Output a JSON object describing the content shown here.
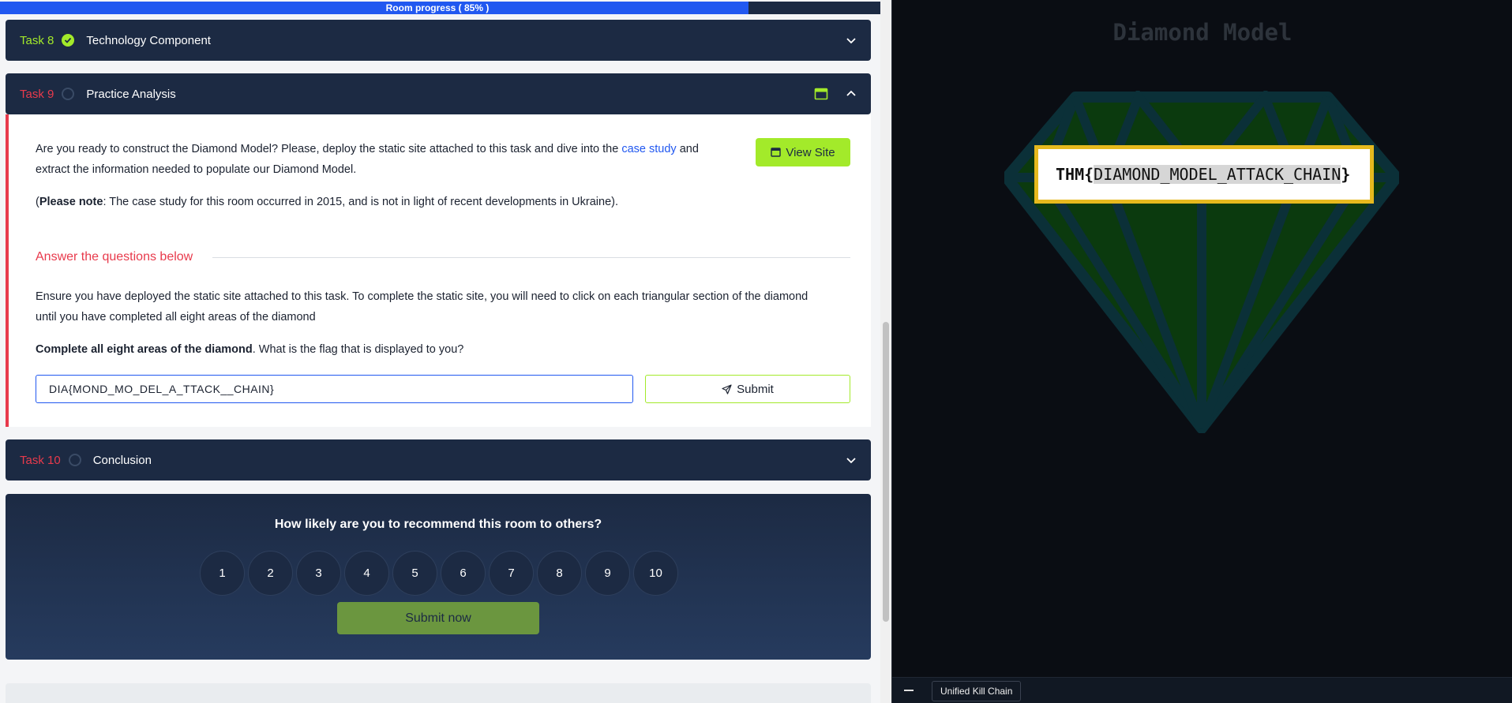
{
  "progress": {
    "label": "Room progress ( 85% )",
    "percent": 85
  },
  "tasks": [
    {
      "num": "Task 8",
      "title": "Technology Component",
      "status": "complete"
    },
    {
      "num": "Task 9",
      "title": "Practice Analysis",
      "status": "incomplete"
    },
    {
      "num": "Task 10",
      "title": "Conclusion",
      "status": "incomplete"
    }
  ],
  "task9": {
    "intro_part1": "Are you ready to construct the Diamond Model? Please, deploy the static site attached to this task and dive into the ",
    "intro_link": "case study",
    "intro_part2": " and",
    "intro_line2": "extract the information needed to populate our Diamond Model.",
    "note_open": "(",
    "note_bold": "Please note",
    "note_rest": ": The case study for this room occurred in 2015, and is not in light of recent developments in Ukraine).",
    "view_site_label": "View Site",
    "answer_heading": "Answer the questions below",
    "question_line1": "Ensure you have deployed the static site attached to this task. To complete the static site, you will need to click on each triangular section of the diamond",
    "question_line2": "until you have completed all eight areas of the diamond",
    "q_bold": "Complete all eight areas of the diamond",
    "q_rest": ". What is the flag that is displayed to you?",
    "answer_value": "DIA{MOND_MO_DEL_A_TTACK__CHAIN}",
    "submit_label": "Submit"
  },
  "rating": {
    "question": "How likely are you to recommend this room to others?",
    "options": [
      "1",
      "2",
      "3",
      "4",
      "5",
      "6",
      "7",
      "8",
      "9",
      "10"
    ],
    "submit_label": "Submit now"
  },
  "site": {
    "title": "Diamond Model",
    "flag_prefix": "THM{",
    "flag_selected": "DIAMOND_MODEL_ATTACK_CHAIN",
    "flag_suffix": "}",
    "taskbar_item": "Unified Kill Chain"
  },
  "colors": {
    "accent_green": "#a3ea2a",
    "accent_red": "#e83a4c",
    "navy": "#1c2a43",
    "progress_blue": "#2158f0",
    "flag_border": "#e6b91e"
  }
}
